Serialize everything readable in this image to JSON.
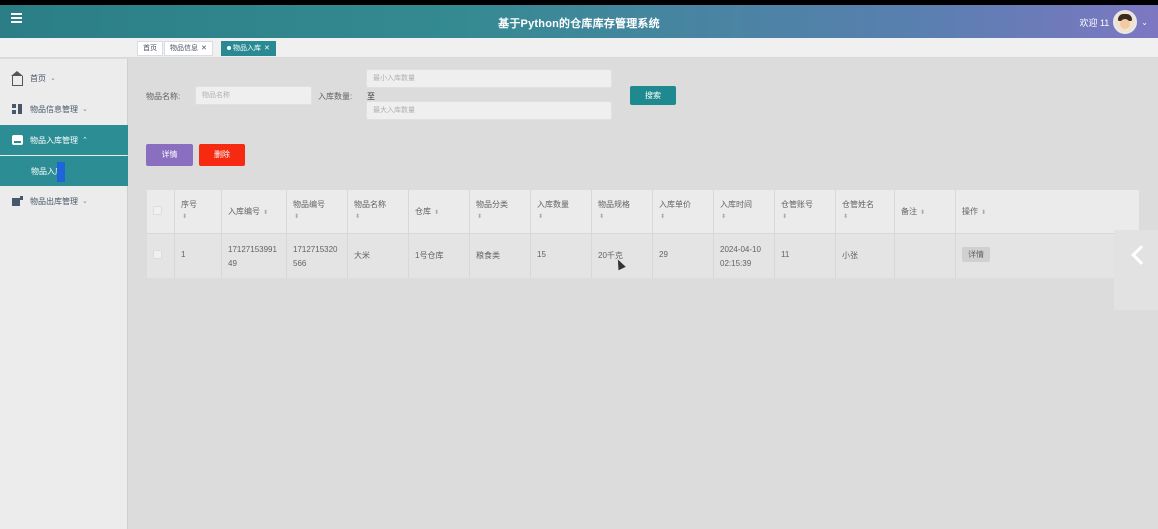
{
  "header": {
    "title": "基于Python的仓库库存管理系统",
    "welcome": "欢迎 11",
    "colors": {
      "gradient_start": "#2b7e86",
      "gradient_end": "#7d77c2"
    }
  },
  "tabs": [
    {
      "label": "首页",
      "closable": false,
      "active": false
    },
    {
      "label": "物品信息",
      "closable": true,
      "active": false
    },
    {
      "label": "物品入库",
      "closable": true,
      "active": true
    }
  ],
  "sidebar": {
    "items": [
      {
        "label": "首页",
        "icon": "home-icon"
      },
      {
        "label": "物品信息管理",
        "icon": "grid-icon"
      },
      {
        "label": "物品入库管理",
        "icon": "inbox-icon",
        "open": true
      },
      {
        "label": "物品出库管理",
        "icon": "outbox-icon"
      }
    ],
    "submenu": {
      "label": "物品入库"
    }
  },
  "search": {
    "name_label": "物品名称:",
    "name_placeholder": "物品名称",
    "qty_label": "入库数量:",
    "min_placeholder": "最小入库数量",
    "range_sep": "至",
    "max_placeholder": "最大入库数量",
    "search_button": "搜索"
  },
  "actions": {
    "detail": "详情",
    "delete": "删除"
  },
  "table": {
    "columns": [
      "序号",
      "入库编号",
      "物品编号",
      "物品名称",
      "仓库",
      "物品分类",
      "入库数量",
      "物品规格",
      "入库单价",
      "入库时间",
      "仓管账号",
      "仓管姓名",
      "备注",
      "操作"
    ],
    "rows": [
      {
        "index": "1",
        "in_no_1": "17127153991",
        "in_no_2": "49",
        "item_no_1": "1712715320",
        "item_no_2": "566",
        "name": "大米",
        "warehouse": "1号仓库",
        "category": "粮食类",
        "quantity": "15",
        "spec": "20千克",
        "price": "29",
        "time_1": "2024-04-10",
        "time_2": "02:15:39",
        "keeper_account": "11",
        "keeper_name": "小张",
        "remark": "",
        "op": "详情"
      }
    ]
  }
}
